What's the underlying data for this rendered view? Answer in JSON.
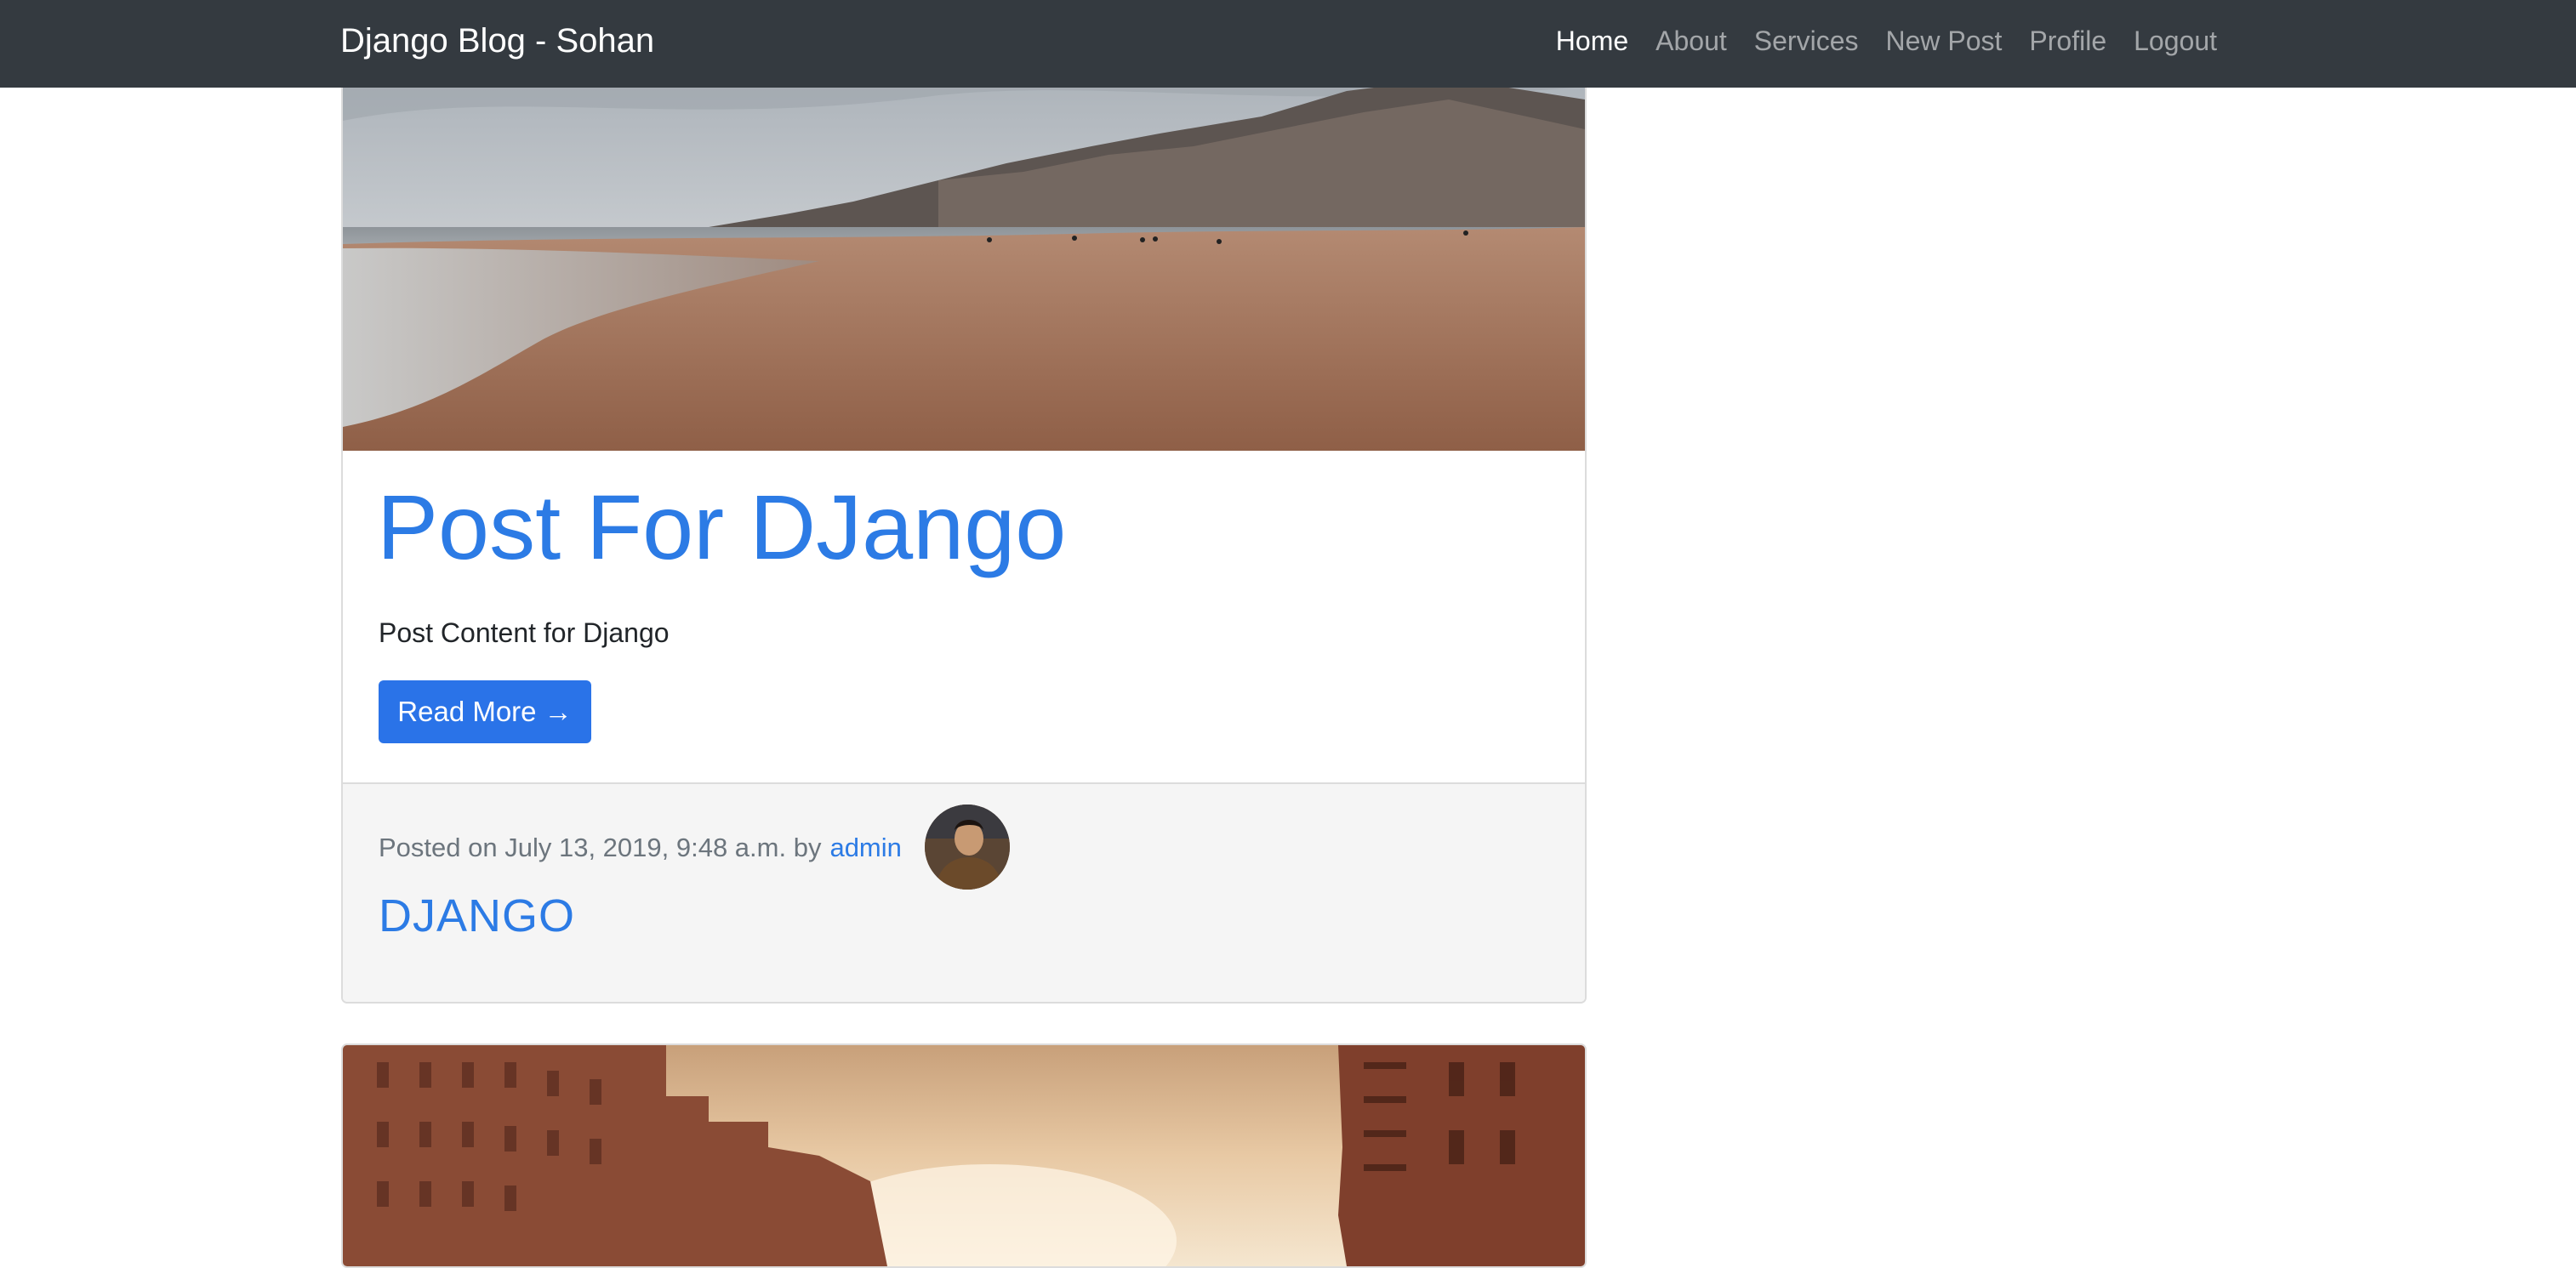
{
  "navbar": {
    "brand": "Django Blog - Sohan",
    "links": [
      {
        "label": "Home",
        "active": true
      },
      {
        "label": "About",
        "active": false
      },
      {
        "label": "Services",
        "active": false
      },
      {
        "label": "New Post",
        "active": false
      },
      {
        "label": "Profile",
        "active": false
      },
      {
        "label": "Logout",
        "active": false
      }
    ]
  },
  "posts": [
    {
      "image_alt": "beach-image",
      "title": "Post For DJango",
      "content": "Post Content for Django",
      "read_more": "Read More →",
      "posted_prefix": "Posted on July 13, 2019, 9:48 a.m. by",
      "author": "admin",
      "category": "DJANGO"
    },
    {
      "image_alt": "city-canal-image"
    }
  ],
  "colors": {
    "navbar_bg": "#343a40",
    "link_blue": "#2c7be5",
    "button_blue": "#2a73e8",
    "footer_bg": "#f5f5f5",
    "muted_text": "#6c757d"
  }
}
